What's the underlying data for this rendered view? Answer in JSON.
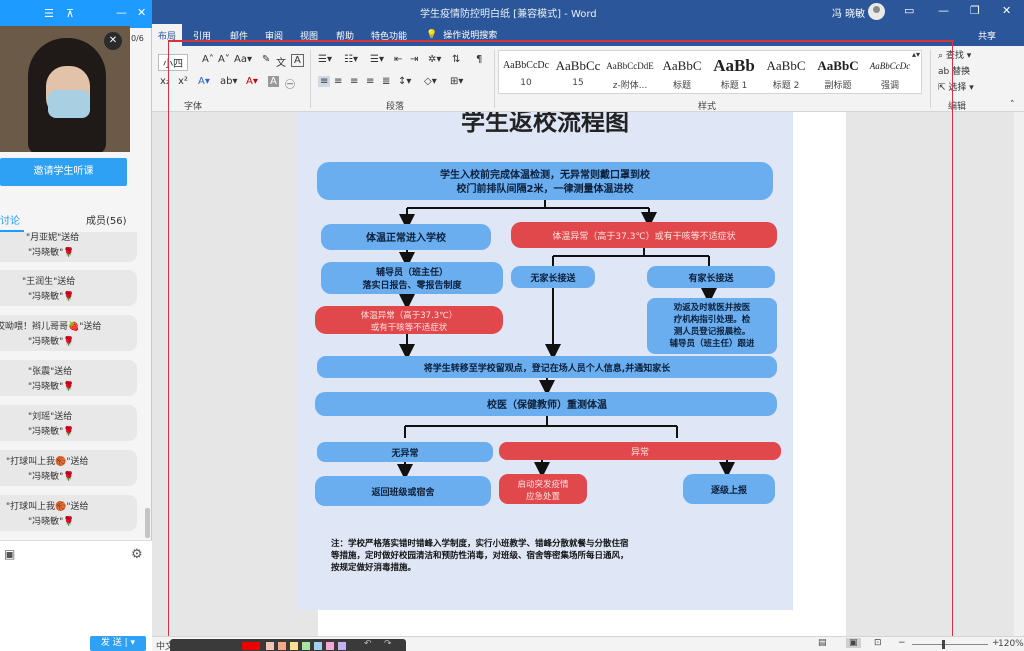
{
  "word": {
    "doc_title": "学生疫情防控明白纸 [兼容模式] - Word",
    "user_name": "冯 晓敏",
    "tabs": [
      "布局",
      "引用",
      "邮件",
      "审阅",
      "视图",
      "帮助",
      "特色功能"
    ],
    "search_label": "操作说明搜索",
    "share_label": "共享",
    "font_size": "小四",
    "groups": {
      "font": "字体",
      "paragraph": "段落",
      "styles": "样式",
      "edit": "编辑"
    },
    "styles": [
      {
        "sample": "AaBbCcDc",
        "name": "10"
      },
      {
        "sample": "AaBbCc",
        "name": "15"
      },
      {
        "sample": "AaBbCcDdE",
        "name": "z-附体..."
      },
      {
        "sample": "AaBbC",
        "name": "标题"
      },
      {
        "sample": "AaBb",
        "name": "标题 1"
      },
      {
        "sample": "AaBbC",
        "name": "标题 2"
      },
      {
        "sample": "AaBbC",
        "name": "副标题"
      },
      {
        "sample": "AaBbCcDc",
        "name": "强调"
      }
    ],
    "edit": {
      "find": "查找",
      "replace": "替换",
      "select": "选择"
    },
    "status": {
      "lang": "中文(中国)",
      "zoom": "120%"
    }
  },
  "panel": {
    "counter": "0/6",
    "invite_label": "邀请学生听课",
    "tab_discuss": "讨论",
    "tab_members": "成员(56)",
    "messages": [
      {
        "l1": "\"月亚妮\"送给",
        "l2": "\"冯晓敏\"🌹"
      },
      {
        "l1": "\"王润生\"送给",
        "l2": "\"冯晓敏\"🌹"
      },
      {
        "l1": "哎呦喂！辫儿哥哥🍓\"送给",
        "l2": "\"冯晓敏\"🌹"
      },
      {
        "l1": "\"张震\"送给",
        "l2": "\"冯晓敏\"🌹"
      },
      {
        "l1": "\"刘瑶\"送给",
        "l2": "\"冯晓敏\"🌹"
      },
      {
        "l1": "\"打球叫上我🏀\"送给",
        "l2": "\"冯晓敏\"🌹"
      },
      {
        "l1": "\"打球叫上我🏀\"送给",
        "l2": "\"冯晓敏\"🌹"
      }
    ],
    "send_label": "发 送"
  },
  "flowchart": {
    "title": "学生返校流程图",
    "step1": [
      "学生入校前完成体温检测，无异常则戴口罩到校",
      "校门前排队间隔2米，一律测量体温进校"
    ],
    "normal": "体温正常进入学校",
    "abnormal_top": "体温异常（高于37.3℃）或有干咳等不适症状",
    "counselor": [
      "辅导员（班主任）",
      "落实日报告、零报告制度"
    ],
    "no_parent": "无家长接送",
    "has_parent": "有家长接送",
    "parent_detail": [
      "劝返及时就医并按医",
      "疗机构指引处理。检",
      "测人员登记报晨检。",
      "辅导员（班主任）跟进"
    ],
    "abnormal_mid": [
      "体温异常（高于37.3℃）",
      "或有干咳等不适症状"
    ],
    "transfer": "将学生转移至学校留观点，登记在场人员个人信息,并通知家长",
    "retest": "校医（保健教师）重测体温",
    "no_anomaly": "无异常",
    "anomaly": "异常",
    "back_class": "返回班级或宿舍",
    "emergency": [
      "启动突发疫情",
      "应急处置"
    ],
    "report": "逐级上报",
    "note": [
      "注：学校严格落实错时错峰入学制度，实行小班教学、错峰分散就餐与分散住宿",
      "等措施，定时做好校园清洁和预防性消毒，对班级、宿舍等密集场所每日通风，",
      "按规定做好消毒措施。"
    ]
  },
  "colors": {
    "word_blue": "#2b579a",
    "panel_blue": "#1e9bff",
    "box_blue": "#6aaef0",
    "box_red": "#e0484c"
  }
}
